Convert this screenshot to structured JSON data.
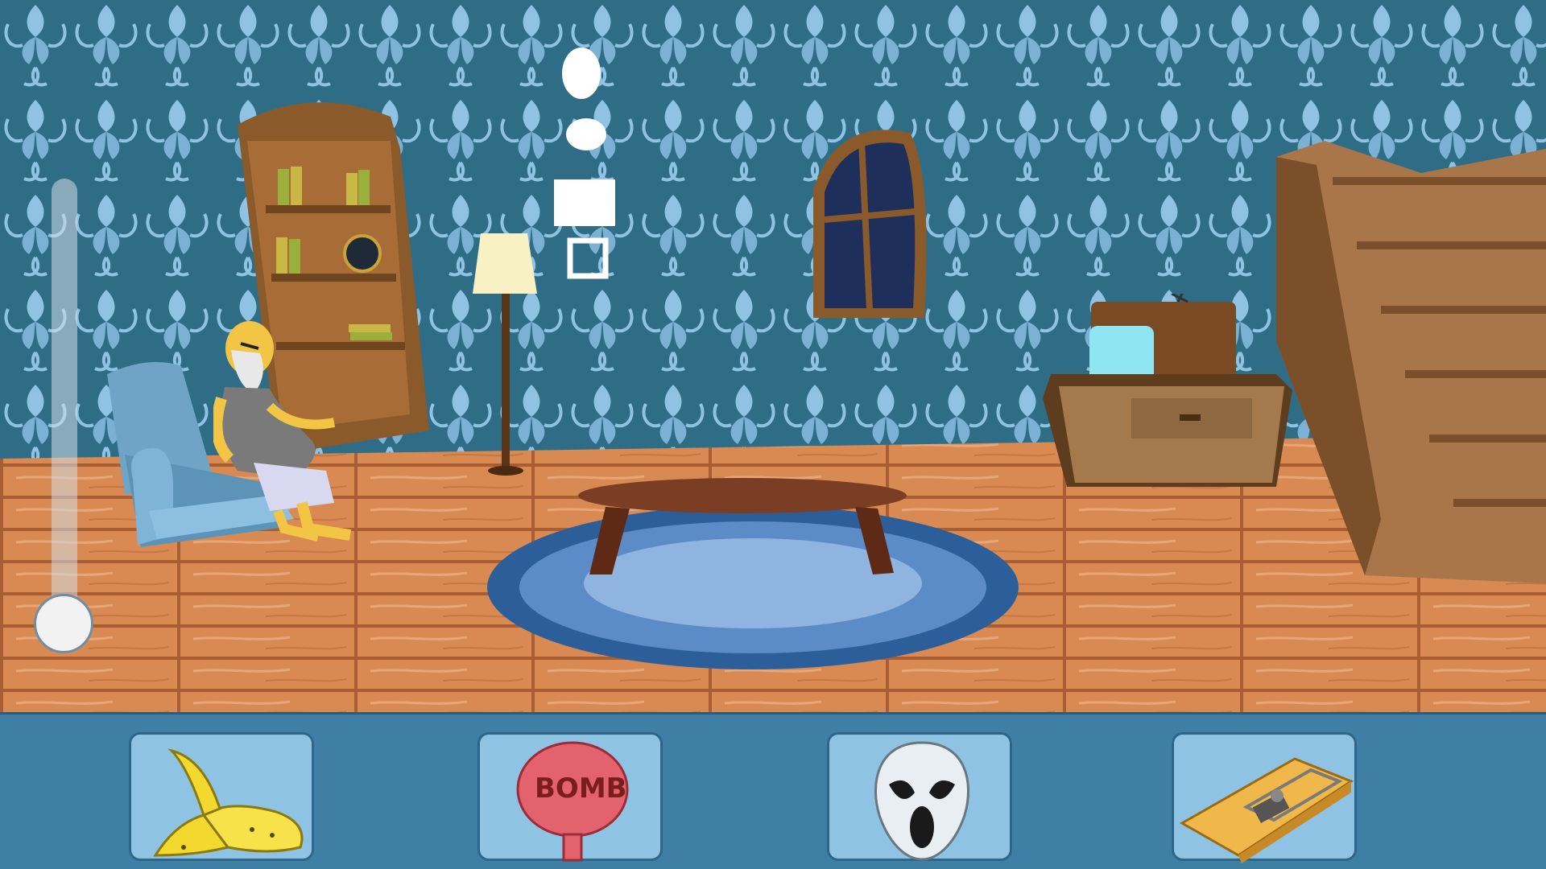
{
  "game": {
    "title": "",
    "toolbar": {
      "items": [
        {
          "id": "banana-peel",
          "icon": "banana-peel-icon",
          "label": ""
        },
        {
          "id": "whoopee-cushion",
          "icon": "bomb-cushion-icon",
          "label": "BOMB"
        },
        {
          "id": "scream-mask",
          "icon": "ghost-mask-icon",
          "label": ""
        },
        {
          "id": "mouse-trap",
          "icon": "mouse-trap-icon",
          "label": ""
        }
      ]
    },
    "slider": {
      "value": 0.0
    }
  },
  "colors": {
    "wall": "#2f6d87",
    "wallPattern": "#8fc3e3",
    "floor": "#d98a52",
    "toolbar": "#3f7fa6",
    "slot": "#8fc3e3"
  }
}
